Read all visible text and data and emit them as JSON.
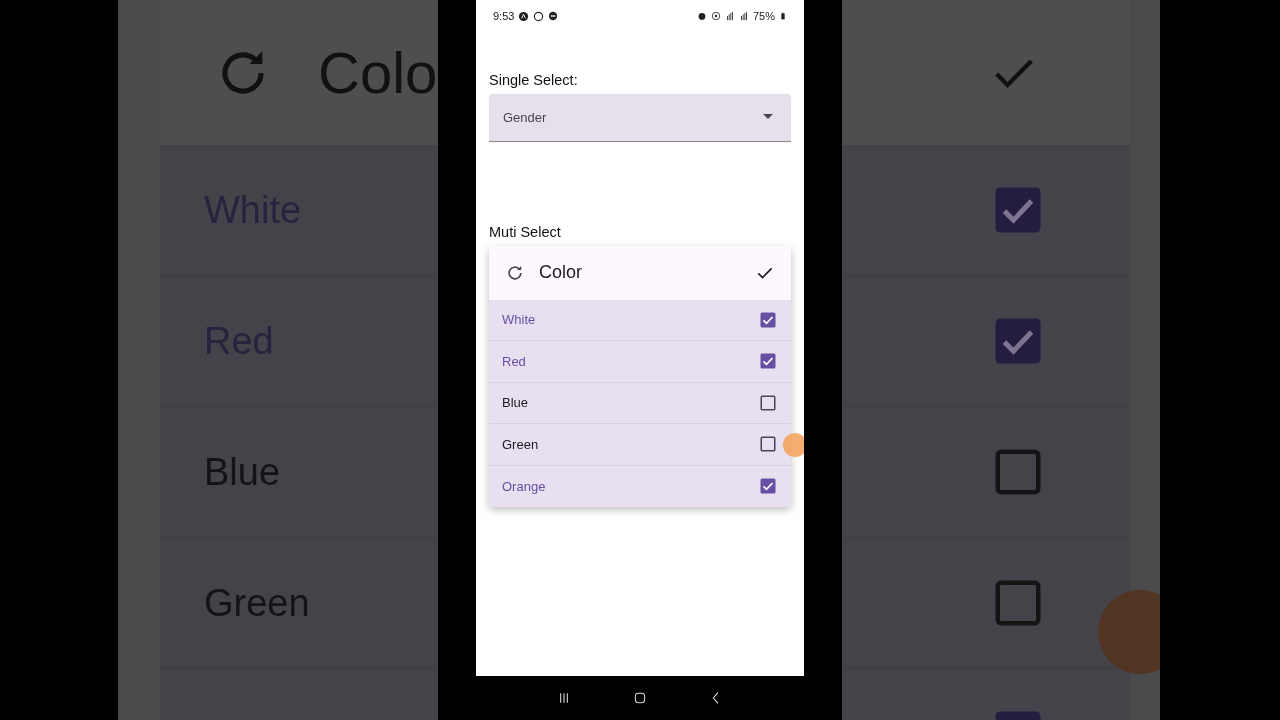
{
  "backdrop": {
    "header_title": "Colo",
    "rows": [
      {
        "label": "White",
        "checked": true
      },
      {
        "label": "Red",
        "checked": true
      },
      {
        "label": "Blue",
        "checked": false
      },
      {
        "label": "Green",
        "checked": false
      },
      {
        "checked": true
      }
    ]
  },
  "status_bar": {
    "time": "9:53",
    "battery": "75%"
  },
  "single_select": {
    "label": "Single Select:",
    "placeholder": "Gender"
  },
  "multi_select": {
    "label": "Muti Select",
    "title": "Color",
    "options": [
      {
        "label": "White",
        "checked": true
      },
      {
        "label": "Red",
        "checked": true
      },
      {
        "label": "Blue",
        "checked": false
      },
      {
        "label": "Green",
        "checked": false
      },
      {
        "label": "Orange",
        "checked": true
      }
    ]
  }
}
